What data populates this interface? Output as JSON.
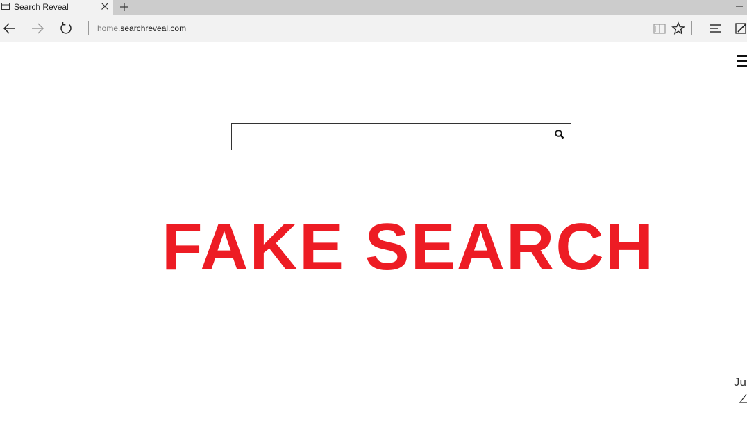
{
  "browser": {
    "tab": {
      "title": "Search Reveal",
      "icon": "page-icon",
      "close_icon": "close-icon"
    },
    "new_tab_icon": "plus-icon",
    "window_controls": {
      "minimize_icon": "minimize-icon"
    },
    "toolbar": {
      "back_icon": "back-arrow-icon",
      "forward_icon": "forward-arrow-icon",
      "refresh_icon": "refresh-icon",
      "address": {
        "prefix": "home.",
        "domain": "searchreveal.com"
      },
      "reading_view_icon": "book-icon",
      "favorite_icon": "star-icon",
      "hub_icon": "hub-icon",
      "web_note_icon": "pen-note-icon"
    }
  },
  "page": {
    "menu_icon": "hamburger-icon",
    "search": {
      "value": "",
      "placeholder": "",
      "button_icon": "search-icon"
    },
    "overlay_text": "FAKE SEARCH",
    "overlay_color": "#ed1c24",
    "date_partial": "Jur"
  }
}
